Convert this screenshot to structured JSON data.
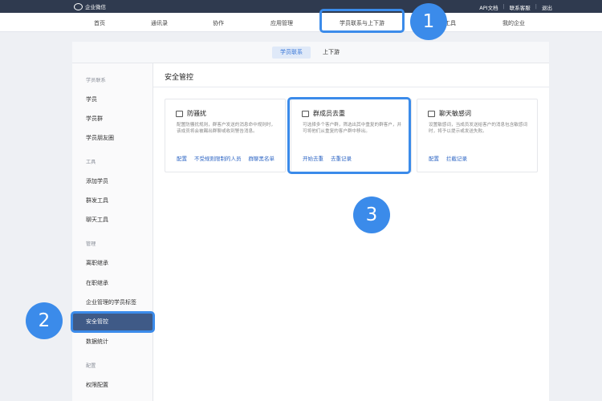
{
  "topbar": {
    "brand": "企业微信",
    "links": [
      "API文档",
      "联系客服",
      "退出"
    ]
  },
  "nav": {
    "items": [
      "首页",
      "通讯录",
      "协作",
      "应用管理",
      "学员联系与上下游",
      "工具",
      "我的企业"
    ]
  },
  "tabs": [
    "学员联系",
    "上下游"
  ],
  "sidebar": {
    "sections": [
      {
        "title": "学员联系",
        "items": [
          "学员",
          "学员群",
          "学员朋友圈"
        ]
      },
      {
        "title": "工具",
        "items": [
          "添加学员",
          "群发工具",
          "聊天工具"
        ]
      },
      {
        "title": "管理",
        "items": [
          "离职继承",
          "在职继承",
          "企业管理的学员标签",
          "安全管控",
          "数据统计"
        ]
      },
      {
        "title": "配置",
        "items": [
          "权限配置"
        ]
      }
    ],
    "active": "安全管控"
  },
  "main": {
    "title": "安全管控",
    "cards": [
      {
        "title": "防骚扰",
        "desc": "配置防骚扰规则，群客户发送的消息命中规则时，该成员将会被踢出群聊或收到警告消息。",
        "actions": [
          "配置",
          "不受规则限制的人员",
          "群聊黑名单"
        ]
      },
      {
        "title": "群成员去重",
        "desc": "可选择多个客户群，筛选出其中重复的群客户，并可将他们从重复的客户群中移出。",
        "actions": [
          "开始去重",
          "去重记录"
        ]
      },
      {
        "title": "聊天敏感词",
        "desc": "设置敏感词，当成员发送给客户的消息包含敏感词时，将予以提示或发送失败。",
        "actions": [
          "配置",
          "拦截记录"
        ]
      }
    ]
  },
  "annotations": {
    "badges": [
      "1",
      "2",
      "3"
    ],
    "color": "#3b8bea"
  }
}
